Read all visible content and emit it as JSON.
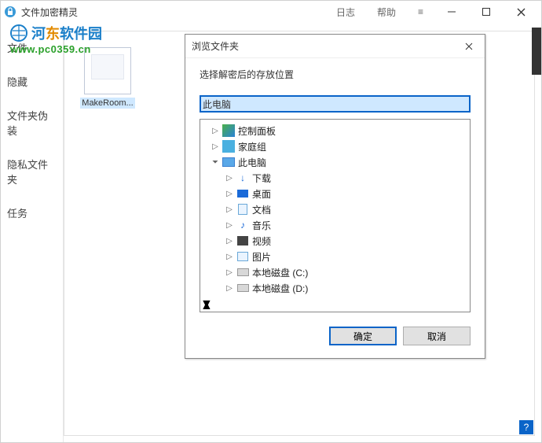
{
  "titlebar": {
    "app_name": "文件加密精灵",
    "menu_log": "日志",
    "menu_help": "帮助",
    "menu_hamburger": "≡"
  },
  "watermark": {
    "text": "河东软件园",
    "url": "www.pc0359.cn"
  },
  "sidebar": {
    "items": [
      {
        "label": "文件"
      },
      {
        "label": "隐藏"
      },
      {
        "label": "文件夹伪装"
      },
      {
        "label": "隐私文件夹"
      },
      {
        "label": "任务"
      }
    ]
  },
  "content": {
    "file_label": "MakeRoom..."
  },
  "dialog": {
    "title": "浏览文件夹",
    "prompt": "选择解密后的存放位置",
    "input_value": "此电脑",
    "ok": "确定",
    "cancel": "取消",
    "tree": {
      "control_panel": "控制面板",
      "home_group": "家庭组",
      "this_pc": "此电脑",
      "downloads": "下载",
      "desktop": "桌面",
      "documents": "文档",
      "music": "音乐",
      "videos": "视频",
      "pictures": "图片",
      "drive_c": "本地磁盘 (C:)",
      "drive_d": "本地磁盘 (D:)"
    }
  },
  "help_button": "?"
}
